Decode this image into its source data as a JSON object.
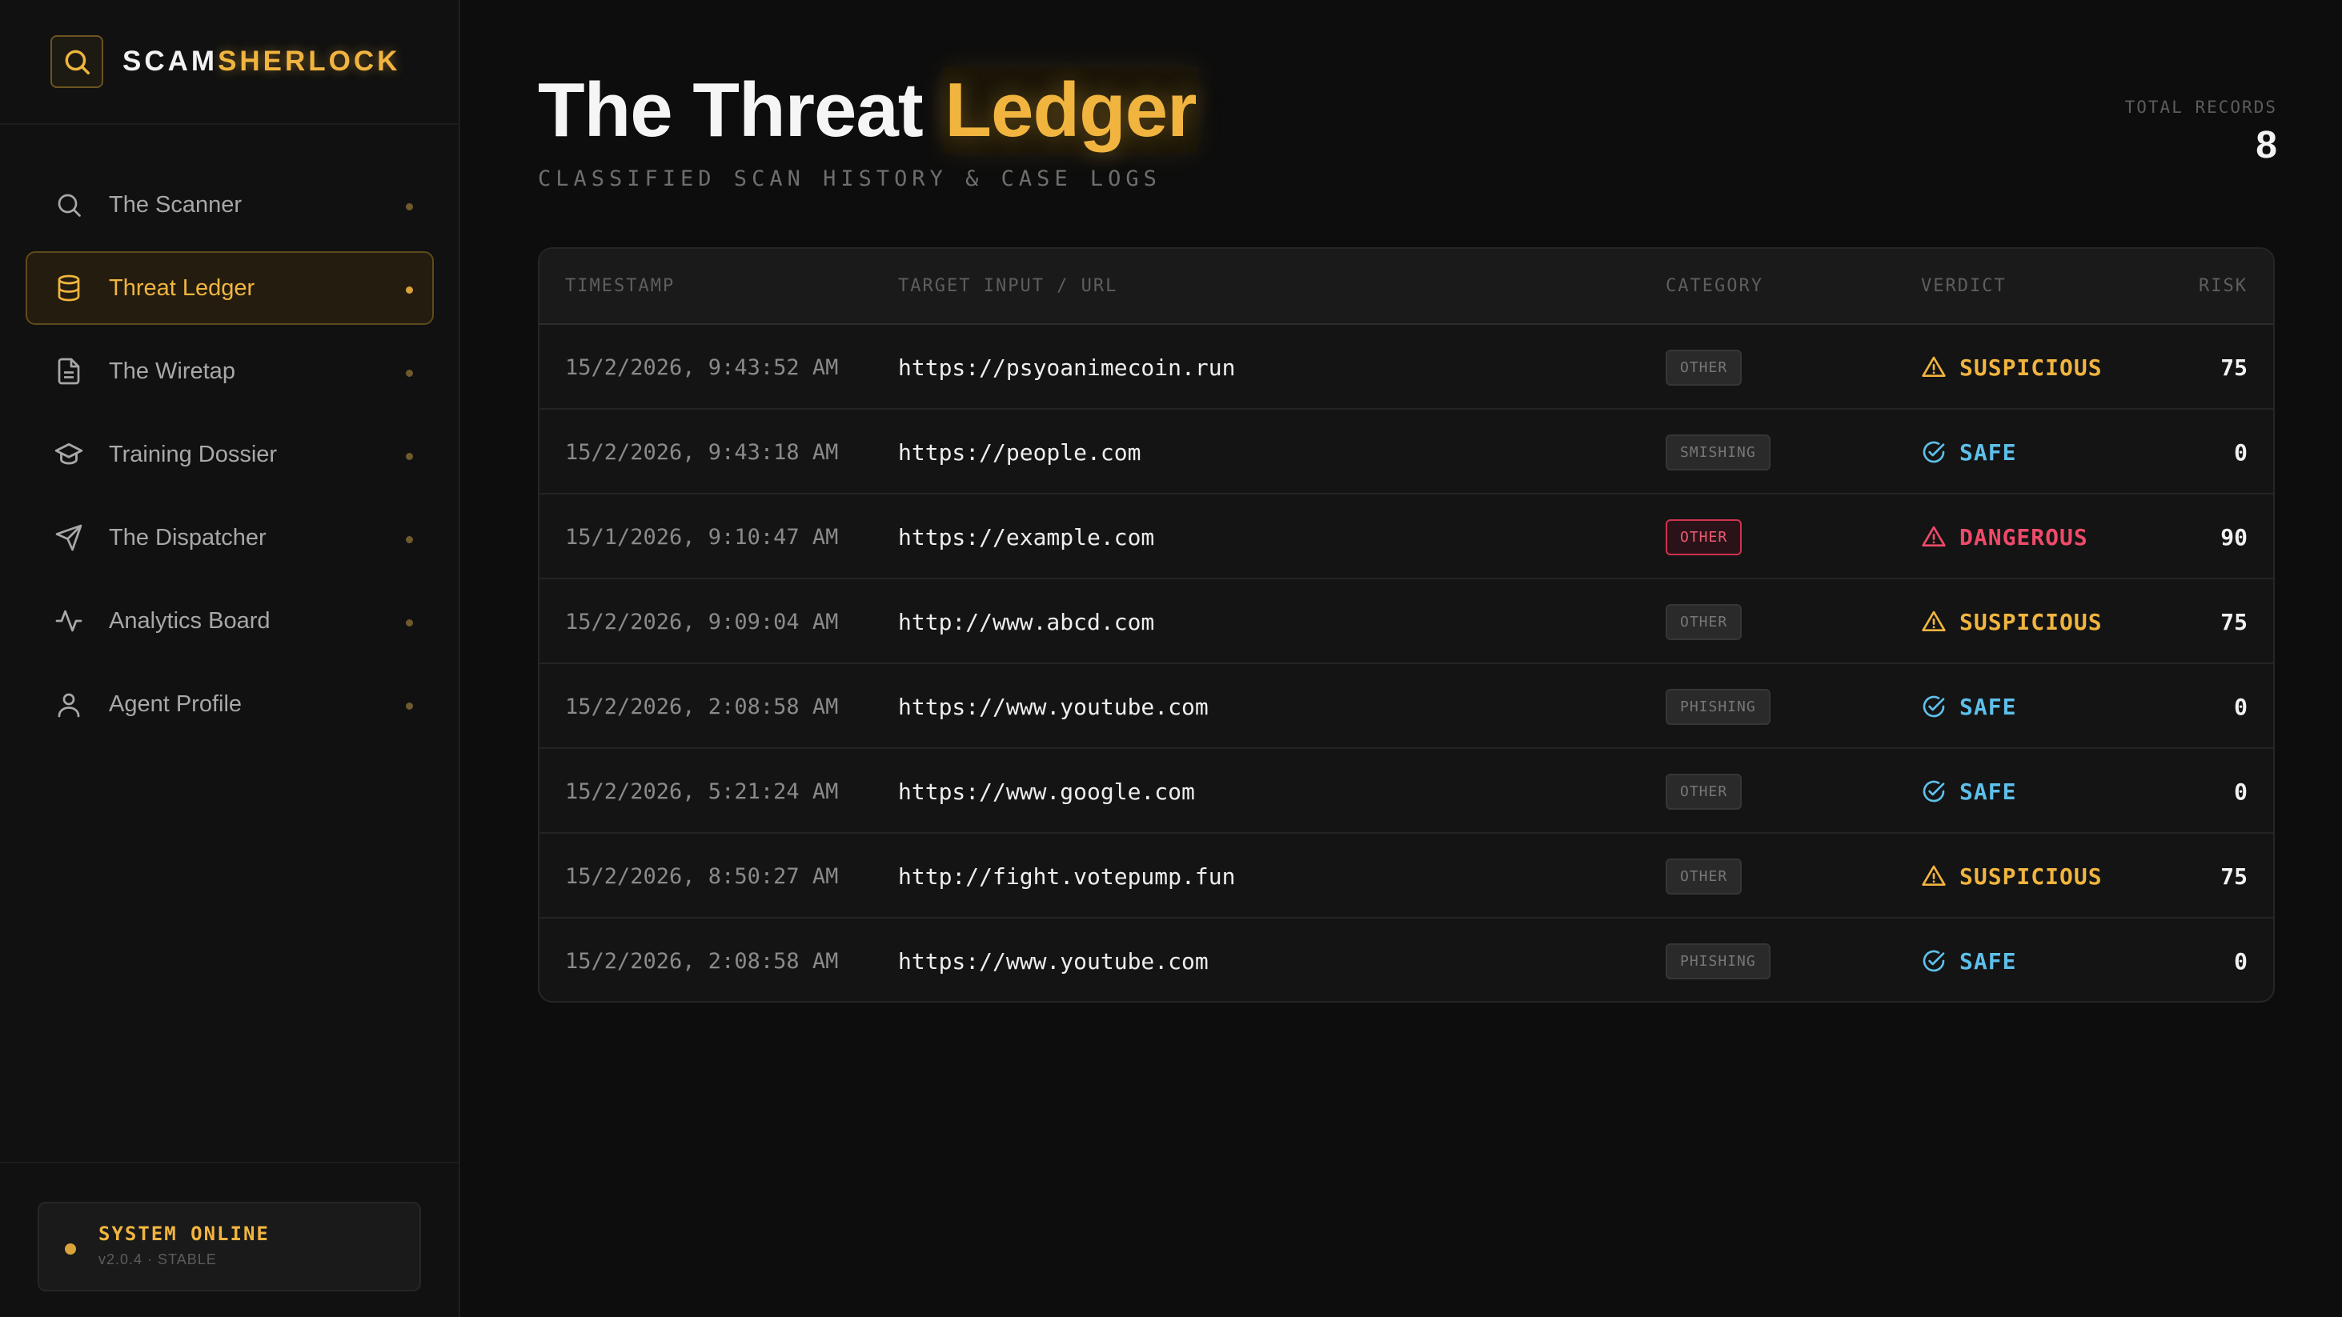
{
  "brand": {
    "name_part1": "SCAM",
    "name_part2": "SHERLOCK",
    "accent": "#f1b53f"
  },
  "sidebar": {
    "items": [
      {
        "label": "The Scanner",
        "icon": "search-icon",
        "active": false
      },
      {
        "label": "Threat Ledger",
        "icon": "database-icon",
        "active": true
      },
      {
        "label": "The Wiretap",
        "icon": "document-icon",
        "active": false
      },
      {
        "label": "Training Dossier",
        "icon": "graduation-cap-icon",
        "active": false
      },
      {
        "label": "The Dispatcher",
        "icon": "send-icon",
        "active": false
      },
      {
        "label": "Analytics Board",
        "icon": "activity-icon",
        "active": false
      },
      {
        "label": "Agent Profile",
        "icon": "user-icon",
        "active": false
      }
    ],
    "status": {
      "title": "SYSTEM ONLINE",
      "version": "v2.0.4 · STABLE"
    }
  },
  "header": {
    "title_part1": "The Threat",
    "title_part2": "Ledger",
    "subtitle": "CLASSIFIED SCAN HISTORY & CASE LOGS",
    "records_label": "TOTAL RECORDS",
    "records_count": "8"
  },
  "table": {
    "columns": [
      "TIMESTAMP",
      "TARGET INPUT / URL",
      "CATEGORY",
      "VERDICT",
      "RISK"
    ],
    "rows": [
      {
        "timestamp": "15/2/2026, 9:43:52 AM",
        "url": "https://psyoanimecoin.run",
        "category": "OTHER",
        "verdict": "SUSPICIOUS",
        "risk": "75"
      },
      {
        "timestamp": "15/2/2026, 9:43:18 AM",
        "url": "https://people.com",
        "category": "SMISHING",
        "verdict": "SAFE",
        "risk": "0"
      },
      {
        "timestamp": "15/1/2026, 9:10:47 AM",
        "url": "https://example.com",
        "category": "OTHER",
        "verdict": "DANGEROUS",
        "risk": "90"
      },
      {
        "timestamp": "15/2/2026, 9:09:04 AM",
        "url": "http://www.abcd.com",
        "category": "OTHER",
        "verdict": "SUSPICIOUS",
        "risk": "75"
      },
      {
        "timestamp": "15/2/2026, 2:08:58 AM",
        "url": "https://www.youtube.com",
        "category": "PHISHING",
        "verdict": "SAFE",
        "risk": "0"
      },
      {
        "timestamp": "15/2/2026, 5:21:24 AM",
        "url": "https://www.google.com",
        "category": "OTHER",
        "verdict": "SAFE",
        "risk": "0"
      },
      {
        "timestamp": "15/2/2026, 8:50:27 AM",
        "url": "http://fight.votepump.fun",
        "category": "OTHER",
        "verdict": "SUSPICIOUS",
        "risk": "75"
      },
      {
        "timestamp": "15/2/2026, 2:08:58 AM",
        "url": "https://www.youtube.com",
        "category": "PHISHING",
        "verdict": "SAFE",
        "risk": "0"
      }
    ]
  },
  "colors": {
    "suspicious": "#f1b53f",
    "safe": "#5ec0ea",
    "dangerous": "#ef4a6a"
  }
}
